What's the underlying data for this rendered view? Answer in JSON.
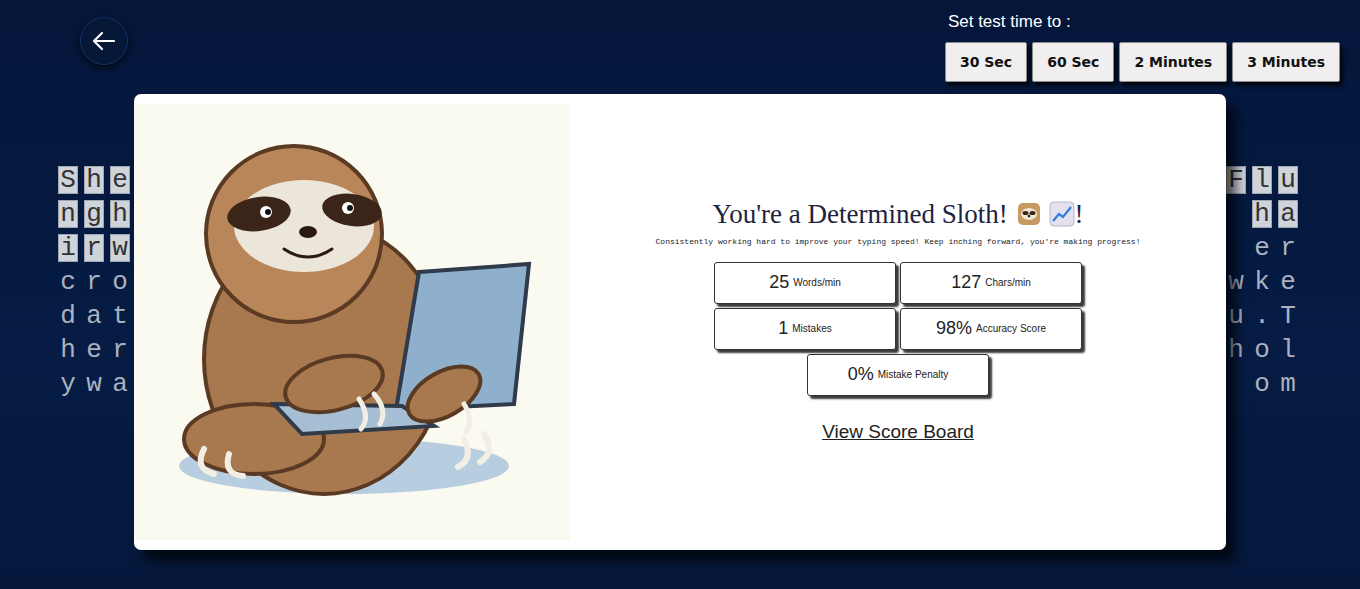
{
  "time_setting": {
    "label": "Set test time to :",
    "options": [
      {
        "label": "30 Sec"
      },
      {
        "label": "60 Sec"
      },
      {
        "label": "2 Minutes"
      },
      {
        "label": "3 Minutes"
      }
    ]
  },
  "passage": {
    "rows": [
      {
        "left": "She",
        "left_typed": true,
        "right": "Flu",
        "right_typed": true
      },
      {
        "left": "ngh",
        "left_typed": true,
        "right": "ha",
        "right_typed": true
      },
      {
        "left": "irw",
        "left_typed": true,
        "right": "er",
        "right_typed": false
      },
      {
        "left": "cro",
        "left_typed": false,
        "right": "wke",
        "right_typed": false
      },
      {
        "left": "dat",
        "left_typed": false,
        "right": "u.T",
        "right_typed": false
      },
      {
        "left": "her",
        "left_typed": false,
        "right": "hol",
        "right_typed": false
      },
      {
        "left": "ywa",
        "left_typed": false,
        "right": "om",
        "right_typed": false
      }
    ]
  },
  "result": {
    "title": "You're a Determined Sloth!",
    "title_end": "!",
    "message": "Consistently working hard to improve your typing speed! Keep inching forward, you're making progress!",
    "stats": [
      {
        "value": "25",
        "label": "Words/min"
      },
      {
        "value": "127",
        "label": "Chars/min"
      },
      {
        "value": "1",
        "label": "Mistakes"
      },
      {
        "value": "98%",
        "label": "Accuracy Score"
      },
      {
        "value": "0%",
        "label": "Mistake Penalty"
      }
    ],
    "link": "View Score Board"
  }
}
